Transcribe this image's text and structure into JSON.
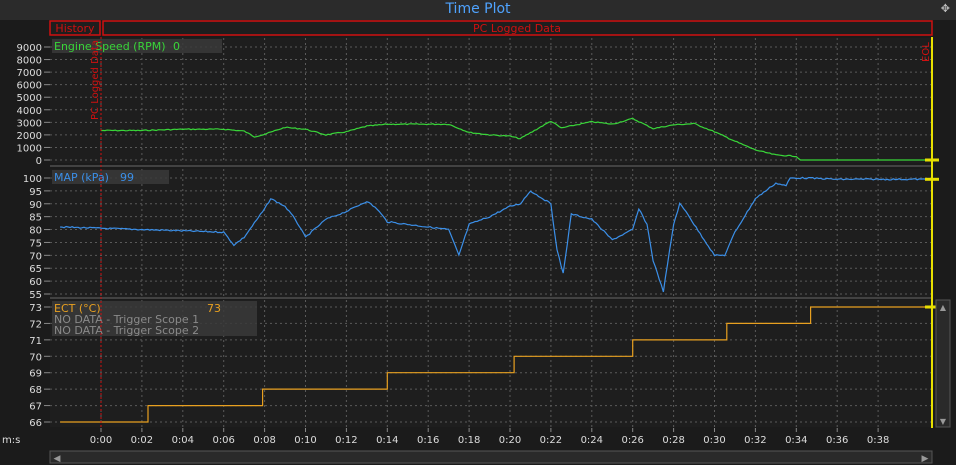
{
  "window": {
    "title": "Time Plot",
    "pin_icon": "pin-icon"
  },
  "tabs": {
    "history": "History",
    "logged": "PC Logged Data"
  },
  "markers": {
    "start": "PC Logged Data",
    "end": "EOL"
  },
  "colors": {
    "rpm": "#39d639",
    "map": "#3b8fe8",
    "ect": "#e8a020",
    "marker": "#d01010",
    "cursor": "#e8e000",
    "grid": "#5a5a5a"
  },
  "time_axis": {
    "label": "m:s",
    "ticks": [
      "0:00",
      "0:02",
      "0:04",
      "0:06",
      "0:08",
      "0:10",
      "0:12",
      "0:14",
      "0:16",
      "0:18",
      "0:20",
      "0:22",
      "0:24",
      "0:26",
      "0:28",
      "0:30",
      "0:32",
      "0:34",
      "0:36",
      "0:38"
    ]
  },
  "panels": [
    {
      "label": "Engine Speed (RPM)",
      "value": "0",
      "ticks": [
        "9000",
        "8000",
        "7000",
        "6000",
        "5000",
        "4000",
        "3000",
        "2000",
        "1000",
        "0"
      ]
    },
    {
      "label": "MAP (kPa)",
      "value": "99",
      "ticks": [
        "100",
        "95",
        "90",
        "85",
        "80",
        "75",
        "70",
        "65",
        "60",
        "55"
      ]
    },
    {
      "label": "ECT (°C)",
      "value": "73",
      "ticks": [
        "73",
        "72",
        "71",
        "70",
        "69",
        "68",
        "67",
        "66"
      ],
      "no_data": [
        "NO DATA - Trigger Scope 1",
        "NO DATA - Trigger Scope 2"
      ]
    }
  ],
  "chart_data": [
    {
      "type": "line",
      "ylabel": "Engine Speed (RPM)",
      "xunit": "seconds",
      "ylim": [
        0,
        9000
      ],
      "series": [
        {
          "name": "Engine Speed (RPM)",
          "points": [
            [
              0,
              2350
            ],
            [
              2,
              2350
            ],
            [
              4,
              2450
            ],
            [
              6,
              2450
            ],
            [
              7,
              2300
            ],
            [
              7.5,
              1850
            ],
            [
              8,
              2050
            ],
            [
              9,
              2600
            ],
            [
              10,
              2450
            ],
            [
              11,
              2000
            ],
            [
              12,
              2250
            ],
            [
              13,
              2700
            ],
            [
              14,
              2850
            ],
            [
              17,
              2850
            ],
            [
              18,
              2200
            ],
            [
              19,
              2000
            ],
            [
              20,
              1900
            ],
            [
              20.5,
              1700
            ],
            [
              22,
              3100
            ],
            [
              22.5,
              2550
            ],
            [
              24,
              3050
            ],
            [
              25,
              2850
            ],
            [
              26,
              3300
            ],
            [
              27,
              2500
            ],
            [
              28,
              2800
            ],
            [
              29,
              2900
            ],
            [
              30,
              2250
            ],
            [
              31,
              1500
            ],
            [
              32,
              800
            ],
            [
              33,
              400
            ],
            [
              34,
              300
            ],
            [
              34.2,
              0
            ],
            [
              40.5,
              0
            ]
          ]
        }
      ]
    },
    {
      "type": "line",
      "ylabel": "MAP (kPa)",
      "xunit": "seconds",
      "ylim": [
        53,
        101
      ],
      "series": [
        {
          "name": "MAP (kPa)",
          "points": [
            [
              -2,
              81
            ],
            [
              2,
              80
            ],
            [
              6,
              79
            ],
            [
              6.5,
              74
            ],
            [
              7,
              77
            ],
            [
              8,
              88
            ],
            [
              8.3,
              92
            ],
            [
              9,
              89
            ],
            [
              9.5,
              84
            ],
            [
              10,
              77
            ],
            [
              11,
              84
            ],
            [
              12,
              87
            ],
            [
              13,
              91
            ],
            [
              13.5,
              88
            ],
            [
              14,
              83
            ],
            [
              16,
              81
            ],
            [
              17,
              80
            ],
            [
              17.5,
              70
            ],
            [
              18,
              82
            ],
            [
              19,
              85
            ],
            [
              20,
              89
            ],
            [
              20.5,
              90
            ],
            [
              21,
              95
            ],
            [
              22,
              90
            ],
            [
              22.3,
              72
            ],
            [
              22.6,
              63
            ],
            [
              23,
              86
            ],
            [
              24,
              84
            ],
            [
              25,
              76
            ],
            [
              26,
              80
            ],
            [
              26.3,
              88
            ],
            [
              26.7,
              82
            ],
            [
              27,
              68
            ],
            [
              27.5,
              56
            ],
            [
              28,
              82
            ],
            [
              28.3,
              90
            ],
            [
              28.7,
              86
            ],
            [
              29,
              82
            ],
            [
              30,
              70
            ],
            [
              30.5,
              70
            ],
            [
              31,
              79
            ],
            [
              32,
              92
            ],
            [
              33,
              98
            ],
            [
              33.5,
              97
            ],
            [
              33.7,
              100
            ],
            [
              34.5,
              100
            ],
            [
              36,
              99.5
            ],
            [
              40.5,
              99.5
            ]
          ]
        }
      ]
    },
    {
      "type": "line",
      "ylabel": "ECT (°C)",
      "xunit": "seconds",
      "ylim": [
        65.8,
        73.3
      ],
      "series": [
        {
          "name": "ECT (°C)",
          "points": [
            [
              -2,
              66
            ],
            [
              2.3,
              66
            ],
            [
              2.3,
              67
            ],
            [
              7.9,
              67
            ],
            [
              7.9,
              68
            ],
            [
              14,
              68
            ],
            [
              14,
              69
            ],
            [
              20.2,
              69
            ],
            [
              20.2,
              70
            ],
            [
              26,
              70
            ],
            [
              26,
              71
            ],
            [
              30.6,
              71
            ],
            [
              30.6,
              72
            ],
            [
              34.7,
              72
            ],
            [
              34.7,
              73
            ],
            [
              40.5,
              73
            ]
          ]
        }
      ]
    }
  ]
}
